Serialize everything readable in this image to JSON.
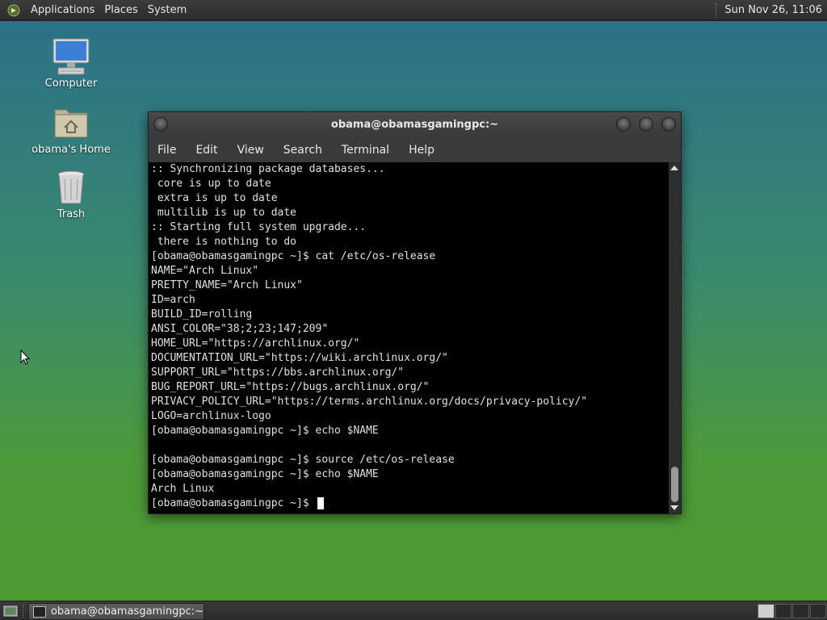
{
  "top_panel": {
    "menus": [
      "Applications",
      "Places",
      "System"
    ],
    "clock": "Sun Nov 26, 11:06"
  },
  "desktop_icons": [
    {
      "label": "Computer",
      "icon": "computer-icon"
    },
    {
      "label": "obama's Home",
      "icon": "home-folder-icon"
    },
    {
      "label": "Trash",
      "icon": "trash-icon"
    }
  ],
  "window": {
    "title": "obama@obamasgamingpc:~",
    "menu": [
      "File",
      "Edit",
      "View",
      "Search",
      "Terminal",
      "Help"
    ]
  },
  "terminal": {
    "lines": [
      ":: Synchronizing package databases...",
      " core is up to date",
      " extra is up to date",
      " multilib is up to date",
      ":: Starting full system upgrade...",
      " there is nothing to do",
      "[obama@obamasgamingpc ~]$ cat /etc/os-release",
      "NAME=\"Arch Linux\"",
      "PRETTY_NAME=\"Arch Linux\"",
      "ID=arch",
      "BUILD_ID=rolling",
      "ANSI_COLOR=\"38;2;23;147;209\"",
      "HOME_URL=\"https://archlinux.org/\"",
      "DOCUMENTATION_URL=\"https://wiki.archlinux.org/\"",
      "SUPPORT_URL=\"https://bbs.archlinux.org/\"",
      "BUG_REPORT_URL=\"https://bugs.archlinux.org/\"",
      "PRIVACY_POLICY_URL=\"https://terms.archlinux.org/docs/privacy-policy/\"",
      "LOGO=archlinux-logo",
      "[obama@obamasgamingpc ~]$ echo $NAME",
      "",
      "[obama@obamasgamingpc ~]$ source /etc/os-release",
      "[obama@obamasgamingpc ~]$ echo $NAME",
      "Arch Linux"
    ],
    "prompt": "[obama@obamasgamingpc ~]$ "
  },
  "taskbar": {
    "window_button": "obama@obamasgamingpc:~"
  }
}
